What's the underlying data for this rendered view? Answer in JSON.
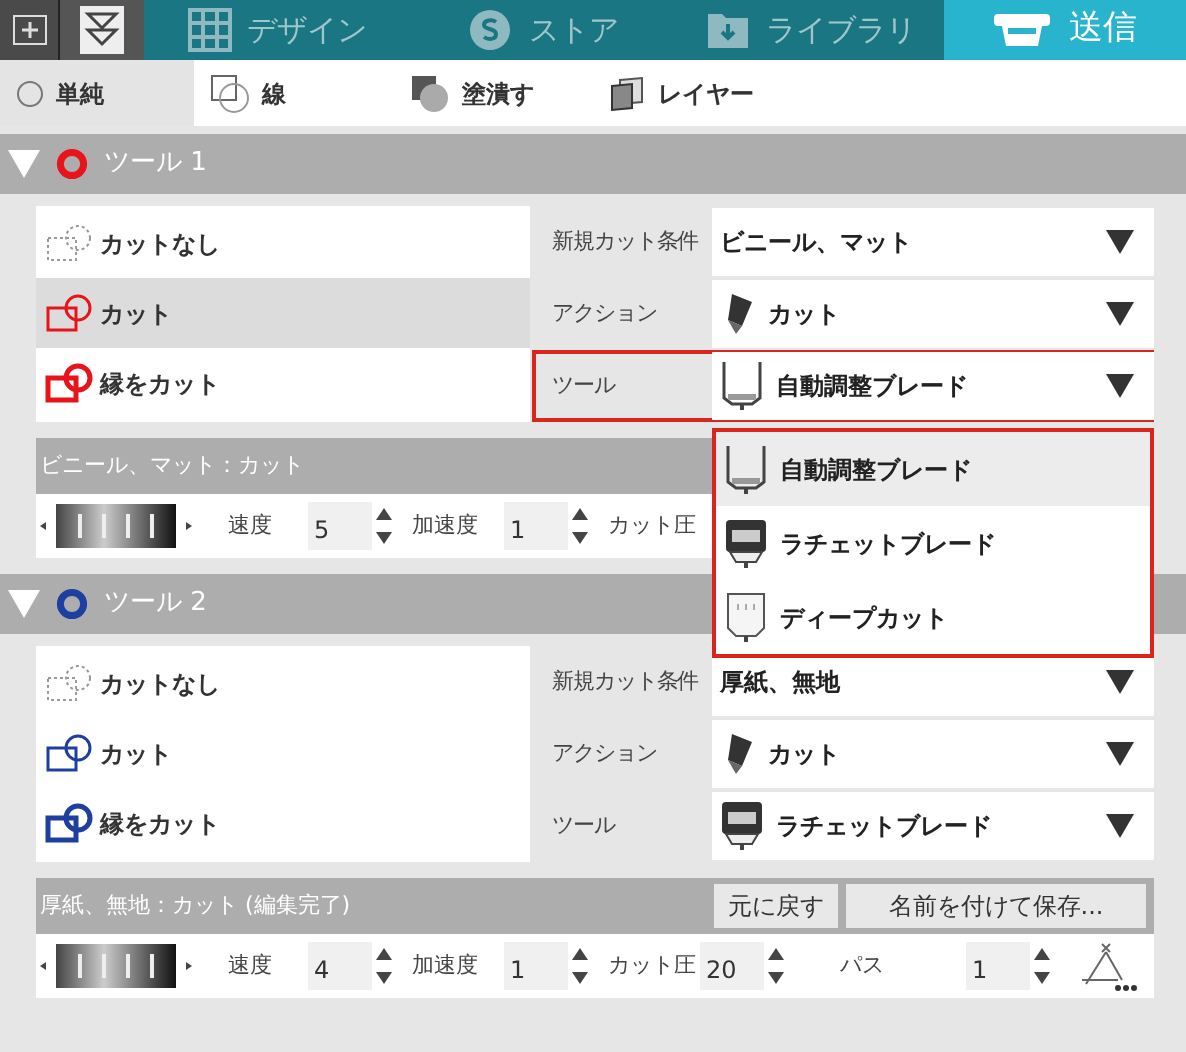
{
  "top_bar": {
    "tabs": [
      {
        "kind": "design",
        "label": "デザイン",
        "selected": false
      },
      {
        "kind": "store",
        "label": "ストア",
        "selected": false
      },
      {
        "kind": "library",
        "label": "ライブラリ",
        "selected": false
      },
      {
        "kind": "send",
        "label": "送信",
        "selected": true
      }
    ]
  },
  "mode_tabs": [
    {
      "kind": "simple",
      "label": "単純",
      "selected": true
    },
    {
      "kind": "line",
      "label": "線",
      "selected": false
    },
    {
      "kind": "fill",
      "label": "塗潰す",
      "selected": false
    },
    {
      "kind": "layer",
      "label": "レイヤー",
      "selected": false
    }
  ],
  "tools": [
    {
      "name": "ツール 1",
      "color": "#e8141c",
      "expanded": true,
      "cut_modes": [
        {
          "kind": "none",
          "label": "カットなし",
          "selected": false
        },
        {
          "kind": "cut",
          "label": "カット",
          "selected": true
        },
        {
          "kind": "edge",
          "label": "縁をカット",
          "selected": false
        }
      ],
      "settings": [
        {
          "kind": "text",
          "label": "新規カット条件",
          "value": "ビニール、マット",
          "highlighted": false
        },
        {
          "kind": "action",
          "label": "アクション",
          "value": "カット",
          "highlighted": false
        },
        {
          "kind": "auto",
          "label": "ツール",
          "value": "自動調整ブレード",
          "highlighted": true,
          "dropdown": [
            {
              "kind": "auto",
              "label": "自動調整ブレード",
              "selected": true
            },
            {
              "kind": "ratchet",
              "label": "ラチェットブレード",
              "selected": false
            },
            {
              "kind": "deep",
              "label": "ディープカット",
              "selected": false
            }
          ]
        }
      ],
      "summary": "ビニール、マット：カット",
      "params": [
        {
          "label": "速度",
          "value": "5"
        },
        {
          "label": "加速度",
          "value": "1"
        },
        {
          "label": "カット圧"
        }
      ],
      "pass_icon": false
    },
    {
      "name": "ツール 2",
      "color": "#1e3fa0",
      "expanded": true,
      "cut_modes": [
        {
          "kind": "none",
          "label": "カットなし",
          "selected": false
        },
        {
          "kind": "cut",
          "label": "カット",
          "selected": false
        },
        {
          "kind": "edge",
          "label": "縁をカット",
          "selected": false
        }
      ],
      "settings": [
        {
          "kind": "text",
          "label": "新規カット条件",
          "value": "厚紙、無地",
          "highlighted": false
        },
        {
          "kind": "action",
          "label": "アクション",
          "value": "カット",
          "highlighted": false
        },
        {
          "kind": "ratchet",
          "label": "ツール",
          "value": "ラチェットブレード",
          "highlighted": false
        }
      ],
      "summary": "厚紙、無地：カット (編集完了)",
      "buttons": [
        "元に戻す",
        "名前を付けて保存..."
      ],
      "params": [
        {
          "label": "速度",
          "value": "4"
        },
        {
          "label": "加速度",
          "value": "1"
        },
        {
          "label": "カット圧",
          "value": "20"
        },
        {
          "label": "パス",
          "value": "1"
        }
      ],
      "pass_icon": true
    }
  ]
}
